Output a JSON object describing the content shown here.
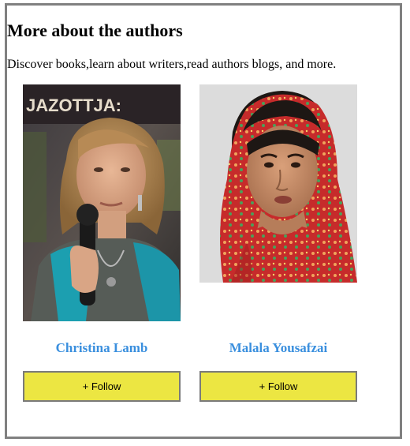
{
  "header": {
    "title": "More about the authors",
    "subtitle": "Discover books,learn about writers,read authors blogs, and more."
  },
  "authors": [
    {
      "name": "Christina Lamb",
      "photo_icon": "author-photo-christina-lamb",
      "photo_banner_text": "JAZOTTJA:",
      "follow_label": "+ Follow"
    },
    {
      "name": "Malala Yousafzai",
      "photo_icon": "author-photo-malala-yousafzai",
      "follow_label": "+ Follow"
    }
  ],
  "colors": {
    "frame_border": "#808080",
    "author_name": "#3a8fde",
    "button_fill": "#ece642",
    "button_border": "#7a7a7a"
  }
}
